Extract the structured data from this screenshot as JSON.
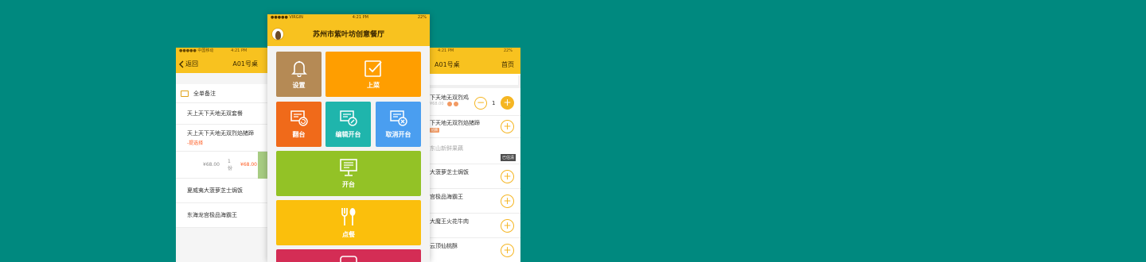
{
  "left_phone": {
    "status": {
      "carrier": "●●●●● 中国移动",
      "time": "4:21 PM"
    },
    "nav": {
      "back_label": "返回",
      "title": "A01号桌"
    },
    "note_label": "全单备注",
    "items": [
      {
        "name": "天上天下天地无双套餐"
      },
      {
        "name": "天上天下天地无双烈焰猪蹄",
        "sub": "-提选择"
      },
      {
        "name": "夏威夷大菠萝芝士焗饭"
      },
      {
        "name": "东海龙宫极品海霸王"
      }
    ],
    "price_row": {
      "orig": "¥68.00",
      "count": "1份",
      "price": "¥68.00"
    }
  },
  "center_phone": {
    "status": {
      "carrier": "●●●●● VIRGIN",
      "time": "4:21 PM",
      "battery": "22%"
    },
    "title": "苏州市紫叶坊创意餐厅",
    "tiles": {
      "settings": "设置",
      "serve": "上菜",
      "flip": "翻台",
      "edit_open": "编辑开台",
      "cancel_open": "取消开台",
      "open": "开台",
      "order": "点餐"
    },
    "colors": {
      "settings": "#b58a55",
      "serve": "#ff9e00",
      "flip": "#f06a1a",
      "edit_open": "#1fb5ac",
      "cancel_open": "#4a9ef0",
      "open": "#93c226",
      "order": "#fbbf0c",
      "bottom": "#d42d55"
    }
  },
  "right_phone": {
    "status": {
      "time": "4:21 PM",
      "battery": "22%"
    },
    "nav": {
      "title": "A01号桌",
      "home": "首页"
    },
    "items": [
      {
        "name": "下天地无双烈鸡",
        "price": "¥68.00",
        "qty": "1"
      },
      {
        "name": "下天地无双烈焰猪蹄",
        "tag": "招牌"
      },
      {
        "name": "东山新鲜果藕",
        "status": "已估清"
      },
      {
        "name": "大菠萝芝士焗饭"
      },
      {
        "name": "宫极品海霸王"
      },
      {
        "name": "大魔王火花牛肉"
      },
      {
        "name": "云顶仙桃酥"
      }
    ]
  }
}
